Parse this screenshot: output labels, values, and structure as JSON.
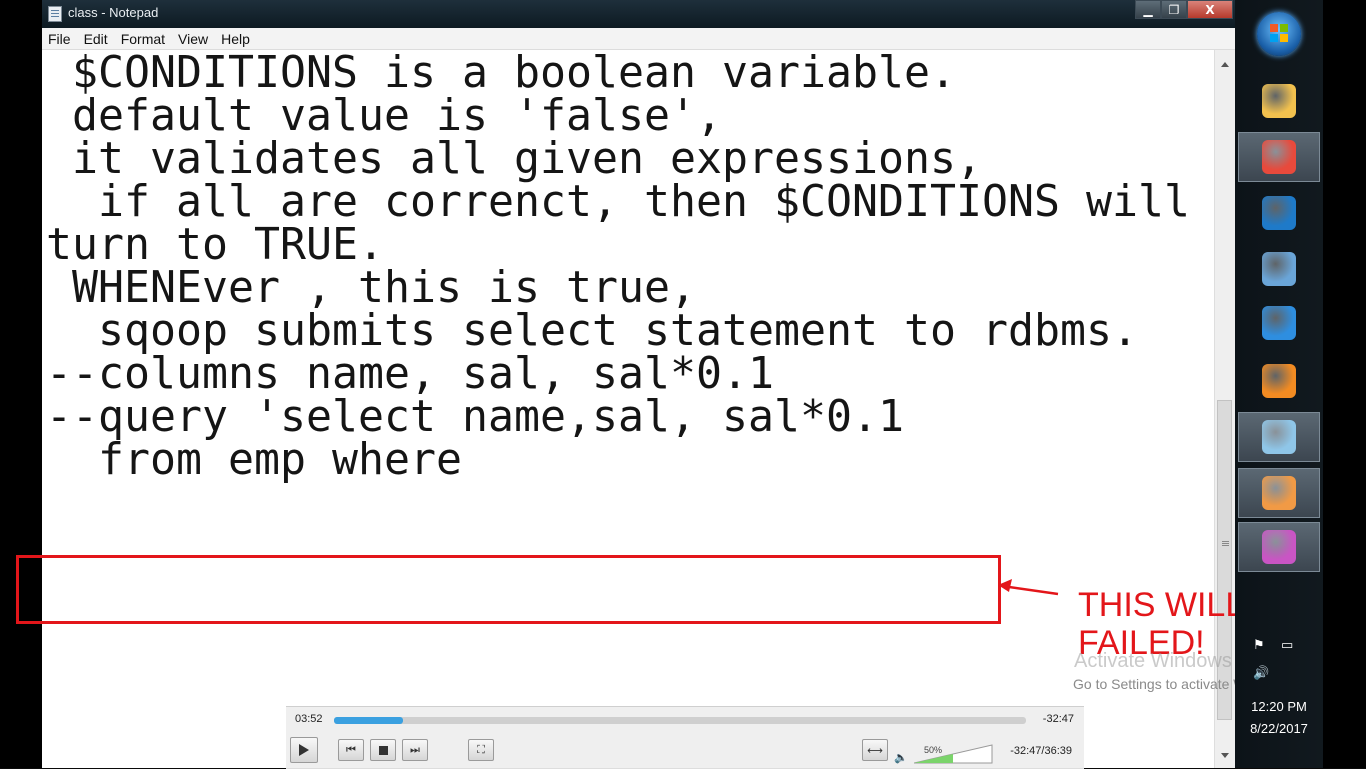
{
  "window": {
    "title": "class - Notepad",
    "minimize_glyph": "▁",
    "maximize_glyph": "❐",
    "close_glyph": "X"
  },
  "menu": [
    "File",
    "Edit",
    "Format",
    "View",
    "Help"
  ],
  "editor": {
    "lines": [
      " $CONDITIONS is a boolean variable.",
      "",
      " default value is 'false',",
      "",
      " it validates all given expressions,",
      "  if all are correnct, then $CONDITIONS will",
      "turn to TRUE.",
      "",
      " WHENEver , this is true,",
      "  sqoop submits select statement to rdbms.",
      "",
      "",
      "--columns name, sal, sal*0.1",
      "",
      "--query 'select name,sal, sal*0.1",
      "  from emp where"
    ]
  },
  "annotation": {
    "note": "THIS WILL\nFAILED!",
    "color": "#e3161a"
  },
  "watermark": {
    "title": "Activate Windows",
    "subtitle": "Go to Settings to activate Windows."
  },
  "player": {
    "elapsed": "03:52",
    "remaining": "-32:47",
    "progress_fraction": 0.1,
    "volume_label": "50%",
    "volume_fraction": 0.5,
    "total": "-32:47/36:39"
  },
  "taskbar": {
    "time": "12:20 PM",
    "date": "8/22/2017",
    "items": [
      {
        "name": "explorer-icon",
        "color": "#f2c14e"
      },
      {
        "name": "chrome-icon",
        "color": "#e84a3c"
      },
      {
        "name": "virtualbox-icon",
        "color": "#1e7ac9"
      },
      {
        "name": "image-viewer-icon",
        "color": "#6aa5d8"
      },
      {
        "name": "ie-icon",
        "color": "#2e8ee0"
      },
      {
        "name": "media-player-icon",
        "color": "#f28b22"
      },
      {
        "name": "notepad-icon",
        "color": "#8fc6e8"
      },
      {
        "name": "flower-app-icon",
        "color": "#f19a45"
      },
      {
        "name": "flower-app-2-icon",
        "color": "#c955c4"
      }
    ]
  }
}
